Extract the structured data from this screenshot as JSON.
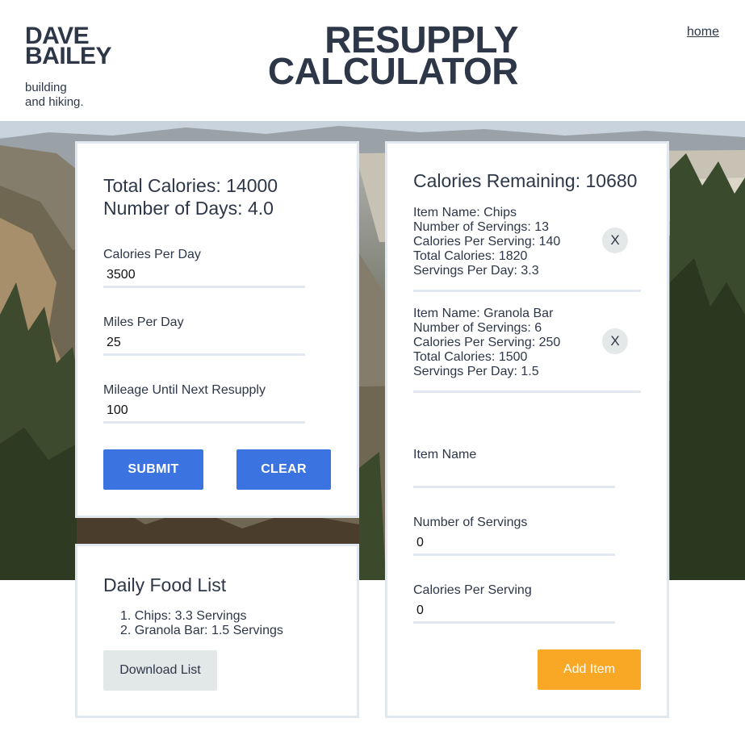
{
  "header": {
    "brand_line1": "DAVE",
    "brand_line2": "BAILEY",
    "tagline_line1": "building",
    "tagline_line2": "and hiking.",
    "title_line1": "RESUPPLY",
    "title_line2": "CALCULATOR",
    "home_link": "home"
  },
  "calculator": {
    "total_calories": "Total Calories: 14000",
    "number_of_days": "Number of Days: 4.0",
    "calories_per_day_label": "Calories Per Day",
    "calories_per_day_value": "3500",
    "miles_per_day_label": "Miles Per Day",
    "miles_per_day_value": "25",
    "mileage_label": "Mileage Until Next Resupply",
    "mileage_value": "100",
    "submit_label": "SUBMIT",
    "clear_label": "CLEAR"
  },
  "food_list": {
    "title": "Daily Food List",
    "items": [
      "1. Chips: 3.3 Servings",
      "2. Granola Bar: 1.5 Servings"
    ],
    "download_label": "Download List"
  },
  "items_panel": {
    "remaining": "Calories Remaining: 10680",
    "items": [
      {
        "name": "Item Name: Chips",
        "servings": "Number of Servings: 13",
        "cal_per_serving": "Calories Per Serving: 140",
        "total": "Total Calories: 1820",
        "per_day": "Servings Per Day: 3.3",
        "remove_label": "X"
      },
      {
        "name": "Item Name: Granola Bar",
        "servings": "Number of Servings: 6",
        "cal_per_serving": "Calories Per Serving: 250",
        "total": "Total Calories: 1500",
        "per_day": "Servings Per Day: 1.5",
        "remove_label": "X"
      }
    ],
    "item_name_label": "Item Name",
    "item_name_value": "",
    "servings_label": "Number of Servings",
    "servings_value": "0",
    "cal_per_serving_label": "Calories Per Serving",
    "cal_per_serving_value": "0",
    "add_label": "Add Item"
  },
  "colors": {
    "primary_button": "#3b73e0",
    "accent_button": "#f9a826",
    "text": "#2d3748",
    "card_border": "#e2e8f0"
  }
}
